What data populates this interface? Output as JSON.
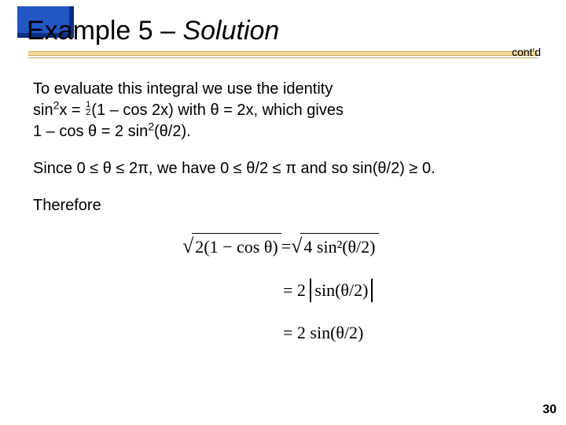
{
  "header": {
    "title_plain": "Example 5 – ",
    "title_italic": "Solution",
    "contd": "cont'd"
  },
  "body": {
    "p1": "To evaluate this integral we use the identity",
    "p1b_a": "sin",
    "p1b_sup": "2",
    "p1b_b": "x = ",
    "p1b_c": "(1 – cos 2x) with θ = 2x, which gives",
    "p1c": "1 – cos θ = 2 sin",
    "p1c_sup": "2",
    "p1c_b": "(θ/2).",
    "p2": "Since 0 ≤ θ ≤ 2π, we have 0 ≤ θ/2 ≤ π and so sin(θ/2) ≥ 0.",
    "p3": "Therefore"
  },
  "math": {
    "lhs_radicand": "2(1 − cos θ)",
    "eq": " = ",
    "rhs1_radicand": "4 sin²(θ/2)",
    "rhs2_pre": "= 2",
    "rhs2_abs": "sin(θ/2)",
    "rhs3": "= 2 sin(θ/2)"
  },
  "half": {
    "num": "1",
    "den": "2"
  },
  "page": "30"
}
